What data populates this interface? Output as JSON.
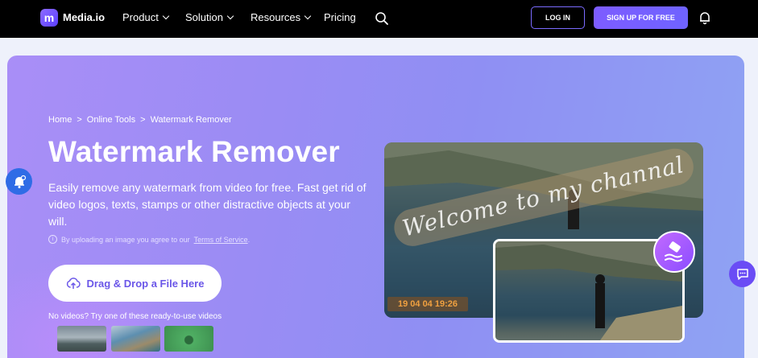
{
  "nav": {
    "logo_letter": "m",
    "logo_text": "Media.io",
    "items": [
      {
        "label": "Product"
      },
      {
        "label": "Solution"
      },
      {
        "label": "Resources"
      },
      {
        "label": "Pricing"
      }
    ],
    "login_label": "LOG IN",
    "signup_label": "SIGN UP FOR FREE"
  },
  "hero": {
    "breadcrumb": [
      "Home",
      ">",
      "Online Tools",
      ">",
      "Watermark Remover"
    ],
    "title": "Watermark Remover",
    "description": "Easily remove any watermark from video for free. Fast get rid of video logos, texts, stamps or other distractive objects at your will.",
    "tos_prefix": "By uploading an image you agree to our",
    "tos_link": "Terms of Service",
    "tos_suffix": ".",
    "upload_label": "Drag & Drop a File Here",
    "no_videos": "No videos? Try one of these ready-to-use videos"
  },
  "preview": {
    "watermark_text": "Welcome to my channal",
    "date_stamp": "19 04 04 19:26"
  },
  "colors": {
    "accent": "#7d5cff",
    "nav_bg": "#000000",
    "upload_text": "#6a56e8"
  }
}
